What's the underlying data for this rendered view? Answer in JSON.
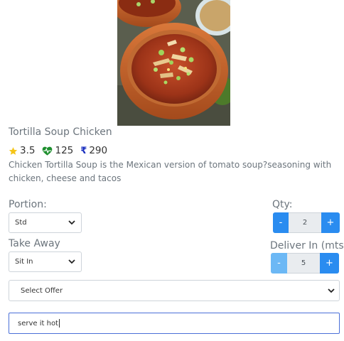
{
  "item": {
    "name": "Tortilla Soup Chicken",
    "rating": "3.5",
    "health_score": "125",
    "price": "290",
    "currency_symbol": "₹",
    "description": "Chicken Tortilla Soup is the Mexican version of tomato soup?seasoning with chicken, cheese and tacos"
  },
  "portion": {
    "label": "Portion:",
    "selected": "Std"
  },
  "service": {
    "label": "Take Away",
    "selected": "Sit In"
  },
  "qty": {
    "label": "Qty:",
    "value": "2",
    "minus": "-",
    "plus": "+"
  },
  "delivery": {
    "label": "Deliver In (mts)",
    "value": "5",
    "minus": "-",
    "plus": "+"
  },
  "offer": {
    "selected": "Select Offer"
  },
  "notes": {
    "value": "serve it hot"
  },
  "icons": {
    "rating": "star-icon",
    "health": "heartbeat-icon",
    "currency": "rupee-icon",
    "dropdown": "chevron-down-icon"
  },
  "colors": {
    "star": "#f5c518",
    "health": "#1e8f2e",
    "currency": "#1a2fbf",
    "stepper": "#2a8cf0",
    "stepper_disabled": "#6cb8f5",
    "focus_border": "#4a6fd8"
  }
}
